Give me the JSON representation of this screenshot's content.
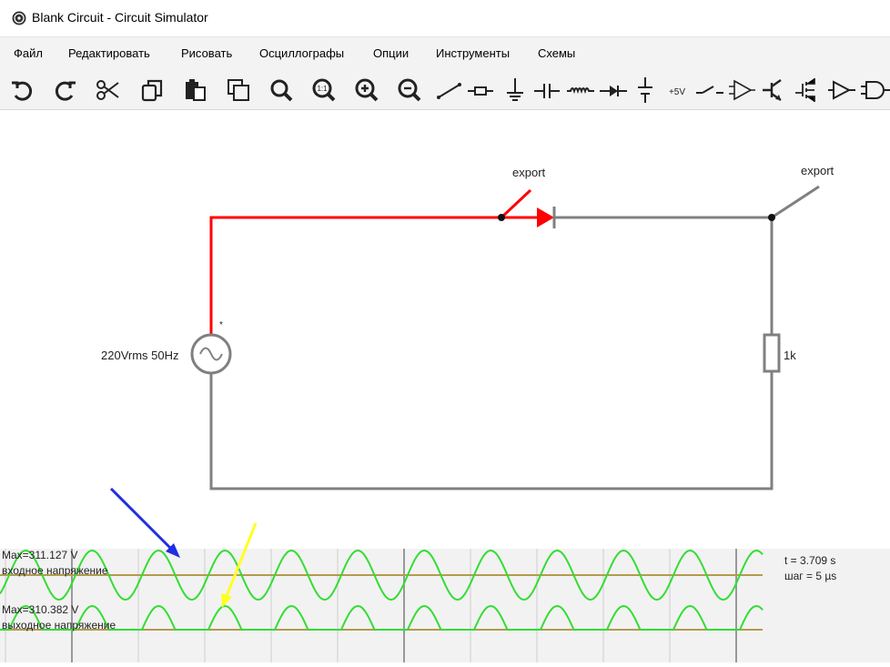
{
  "window": {
    "title": "Blank Circuit - Circuit Simulator",
    "icon": "circuit-app-icon"
  },
  "menu": {
    "items": [
      "Файл",
      "Редактировать",
      "Рисовать",
      "Осциллографы",
      "Опции",
      "Инструменты",
      "Схемы"
    ]
  },
  "toolbar": {
    "tools": [
      {
        "name": "undo-icon"
      },
      {
        "name": "redo-icon"
      },
      {
        "name": "cut-icon"
      },
      {
        "name": "copy-icon"
      },
      {
        "name": "paste-icon"
      },
      {
        "name": "duplicate-icon"
      },
      {
        "name": "zoom-fit-icon"
      },
      {
        "name": "zoom-100-icon",
        "label": "1:1"
      },
      {
        "name": "zoom-in-icon"
      },
      {
        "name": "zoom-out-icon"
      },
      {
        "name": "wire-icon"
      },
      {
        "name": "resistor-icon"
      },
      {
        "name": "ground-icon"
      },
      {
        "name": "capacitor-icon"
      },
      {
        "name": "inductor-icon"
      },
      {
        "name": "diode-icon"
      },
      {
        "name": "voltage-source-icon"
      },
      {
        "name": "rail-icon",
        "label": "+5V"
      },
      {
        "name": "switch-icon"
      },
      {
        "name": "opamp-icon"
      },
      {
        "name": "transistor-icon"
      },
      {
        "name": "mosfet-icon"
      },
      {
        "name": "buffer-icon"
      },
      {
        "name": "and-gate-icon"
      }
    ]
  },
  "circuit": {
    "source_label": "220Vrms 50Hz",
    "source_marker": "*",
    "resistor_label": "1k",
    "export_label_1": "export",
    "export_label_2": "export",
    "colors": {
      "active_wire": "#ff0000",
      "idle_wire": "#808080"
    }
  },
  "scope": {
    "trace1_max": "Max=311.127 V",
    "trace1_name": "входное напряжение",
    "trace2_max": "Max=310.382 V",
    "trace2_name": "выходное напряжение",
    "time": "t = 3.709 s",
    "step": "шаг = 5 µs",
    "colors": {
      "trace": "#33dd33",
      "baseline": "#b39b4f",
      "grid": "#aaaaaa"
    }
  },
  "annotations": {
    "colors": {
      "arrow_blue": "#1f2fe0",
      "arrow_yellow": "#ffff22"
    }
  }
}
